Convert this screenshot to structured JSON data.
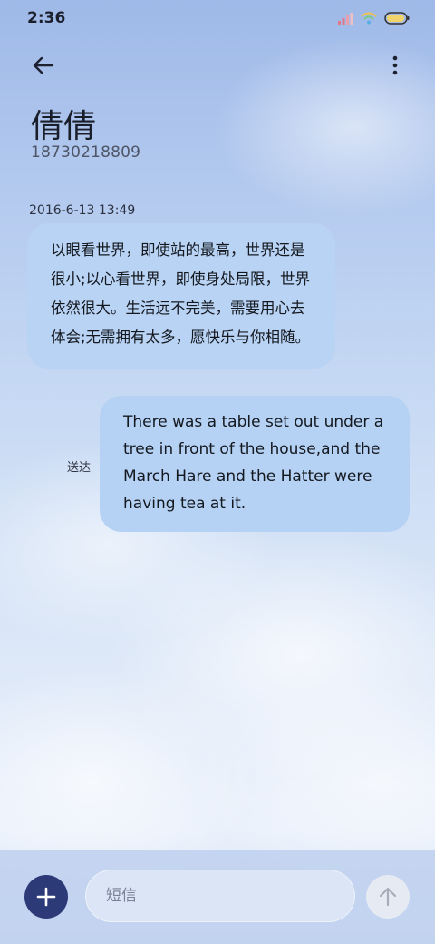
{
  "status_bar": {
    "time": "2:36",
    "icons": [
      "signal-icon",
      "wifi-icon",
      "battery-icon"
    ]
  },
  "header": {
    "back_icon": "back-arrow-icon",
    "more_icon": "more-vertical-icon"
  },
  "contact": {
    "name": "倩倩",
    "number": "18730218809"
  },
  "conversation": {
    "timestamp": "2016-6-13 13:49",
    "incoming_message": "以眼看世界，即使站的最高，世界还是很小;以心看世界，即使身处局限，世界依然很大。生活远不完美，需要用心去体会;无需拥有太多，愿快乐与你相随。",
    "outgoing_message": "There was a table set out under a tree in front of the house,and the March Hare and the Hatter were having tea at it.",
    "outgoing_status": "送达"
  },
  "composer": {
    "add_icon": "plus-icon",
    "placeholder": "短信",
    "value": "",
    "send_icon": "send-arrow-up-icon"
  },
  "colors": {
    "bubble": "#b9d3f4",
    "add_button": "#2d3a78",
    "send_button": "#e6ebf3",
    "text_dark": "#14181f"
  }
}
